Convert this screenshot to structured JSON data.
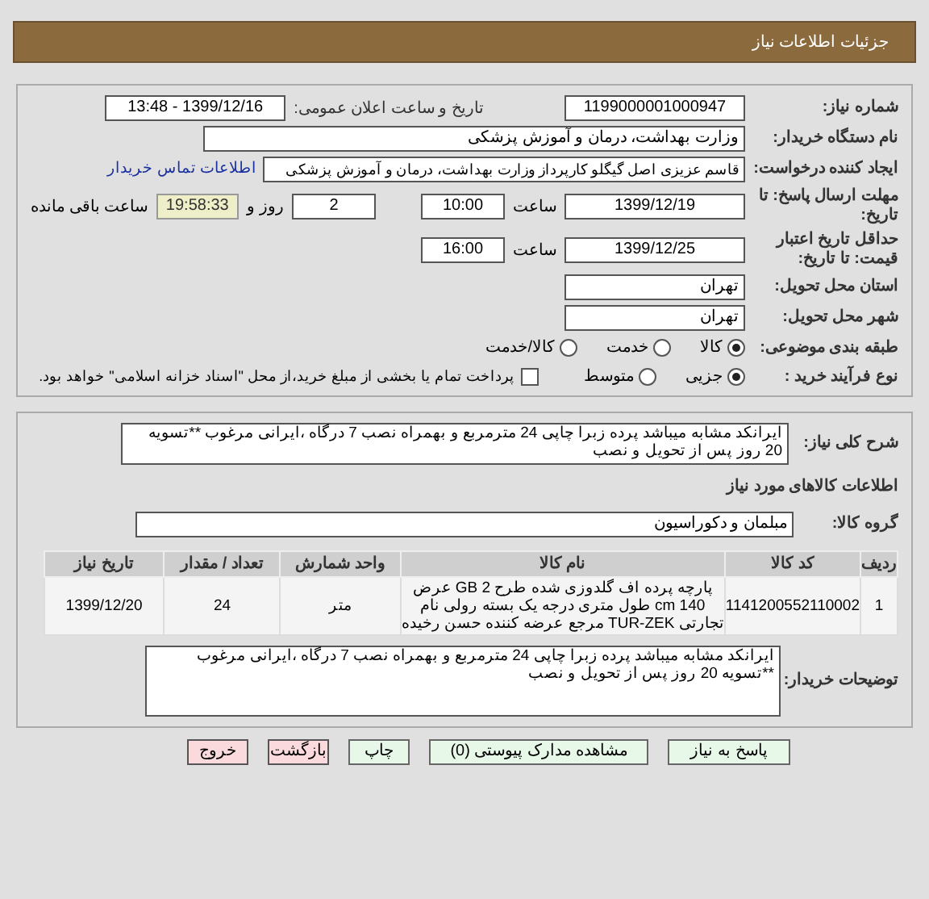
{
  "header": {
    "title": "جزئیات اطلاعات نیاز"
  },
  "need_number": {
    "label": "شماره نیاز:",
    "value": "1199000001000947"
  },
  "announcement": {
    "label": "تاریخ و ساعت اعلان عمومی:",
    "value": "1399/12/16 - 13:48"
  },
  "buyer_org": {
    "label": "نام دستگاه خریدار:",
    "value": "وزارت بهداشت، درمان و آموزش پزشکی"
  },
  "requester": {
    "label": "ایجاد کننده درخواست:",
    "value": "قاسم عزیزی اصل گیگلو کارپرداز وزارت بهداشت، درمان و آموزش پزشکی",
    "link": "اطلاعات تماس خریدار"
  },
  "reply_deadline": {
    "label": "مهلت ارسال پاسخ: تا تاریخ:",
    "date": "1399/12/19",
    "time_label": "ساعت",
    "time": "10:00",
    "days": "2",
    "days_label": "روز و",
    "countdown": "19:58:33",
    "remaining_label": "ساعت باقی مانده"
  },
  "price_validity": {
    "label": "حداقل تاریخ اعتبار قیمت: تا تاریخ:",
    "date": "1399/12/25",
    "time_label": "ساعت",
    "time": "16:00"
  },
  "province": {
    "label": "استان محل تحویل:",
    "value": "تهران"
  },
  "city": {
    "label": "شهر محل تحویل:",
    "value": "تهران"
  },
  "category": {
    "label": "طبقه بندی موضوعی:",
    "options": [
      {
        "label": "کالا",
        "selected": true
      },
      {
        "label": "خدمت",
        "selected": false
      },
      {
        "label": "کالا/خدمت",
        "selected": false
      }
    ]
  },
  "purchase_type": {
    "label": "نوع فرآیند خرید :",
    "options": [
      {
        "label": "جزیی",
        "selected": true
      },
      {
        "label": "متوسط",
        "selected": false
      }
    ],
    "treasury": {
      "label": "پرداخت تمام یا بخشی از مبلغ خرید،از محل \"اسناد خزانه اسلامی\" خواهد بود.",
      "checked": false
    }
  },
  "general_description": {
    "label": "شرح کلی نیاز:",
    "value": "ایرانکد مشابه میباشد پرده زبرا چاپی 24 مترمربع و بهمراه نصب 7 درگاه ،ایرانی مرغوب **تسویه 20 روز پس از تحویل و نصب"
  },
  "goods_heading": "اطلاعات کالاهای مورد نیاز",
  "goods_group": {
    "label": "گروه کالا:",
    "value": "مبلمان و دکوراسیون"
  },
  "table": {
    "columns": [
      "ردیف",
      "کد کالا",
      "نام کالا",
      "واحد شمارش",
      "تعداد / مقدار",
      "تاریخ نیاز"
    ],
    "rows": [
      [
        "1",
        "1141200552110002",
        "پارچه پرده اف گلدوزی شده طرح GB 2 عرض 140 cm طول متری درجه یک بسته رولی نام تجارتی TUR-ZEK مرجع عرضه کننده حسن رخیده",
        "متر",
        "24",
        "1399/12/20"
      ]
    ]
  },
  "buyer_notes": {
    "label": "توضیحات خریدار:",
    "value": "ایرانکد مشابه میباشد پرده زبرا چاپی 24 مترمربع و بهمراه نصب 7 درگاه ،ایرانی مرغوب **تسویه 20 روز پس از تحویل و نصب"
  },
  "buttons": [
    {
      "label": "پاسخ به نیاز",
      "kind": "action"
    },
    {
      "label": "مشاهده مدارک پیوستی (0)",
      "kind": "action"
    },
    {
      "label": "چاپ",
      "kind": "action"
    },
    {
      "label": "بازگشت",
      "kind": "exit"
    },
    {
      "label": "خروج",
      "kind": "exit"
    }
  ]
}
